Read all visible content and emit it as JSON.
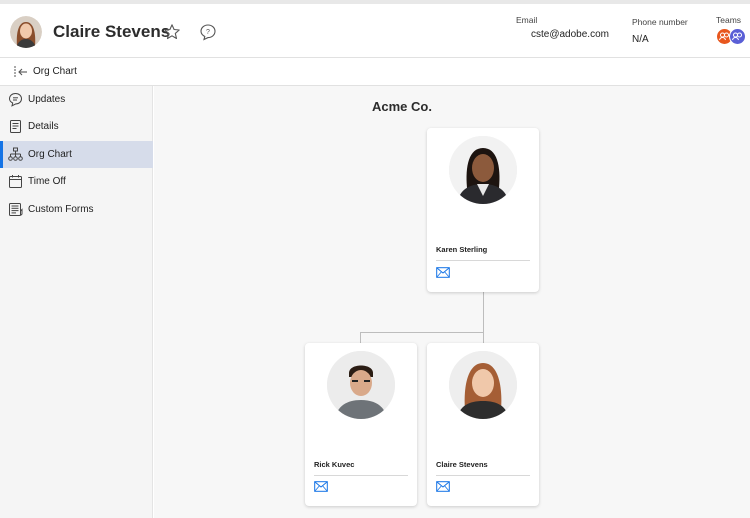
{
  "header": {
    "user_name": "Claire Stevens",
    "email_label": "Email",
    "email_value": "cste@adobe.com",
    "phone_label": "Phone number",
    "phone_value": "N/A",
    "teams_label": "Teams"
  },
  "subbar": {
    "title": "Org Chart"
  },
  "sidebar": {
    "items": [
      {
        "label": "Updates",
        "icon": "comment-icon"
      },
      {
        "label": "Details",
        "icon": "document-icon"
      },
      {
        "label": "Org Chart",
        "icon": "org-chart-icon",
        "active": true
      },
      {
        "label": "Time Off",
        "icon": "calendar-icon"
      },
      {
        "label": "Custom Forms",
        "icon": "forms-icon"
      }
    ]
  },
  "org": {
    "company": "Acme Co.",
    "manager": {
      "name": "Karen Sterling"
    },
    "reports": [
      {
        "name": "Rick Kuvec"
      },
      {
        "name": "Claire Stevens"
      }
    ]
  },
  "colors": {
    "accent": "#1473e6",
    "active_nav_bg": "#d6dcea",
    "team_badge_1": "#e8571e",
    "team_badge_2": "#5a5fd6"
  }
}
